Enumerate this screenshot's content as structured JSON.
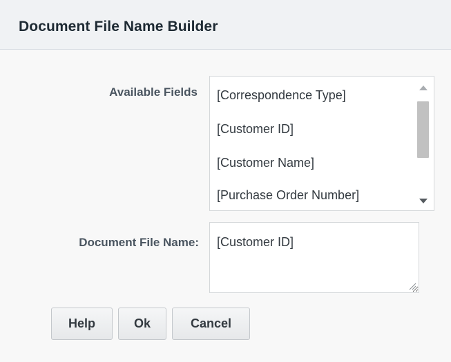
{
  "dialog": {
    "title": "Document File Name Builder"
  },
  "available_fields": {
    "label": "Available Fields",
    "items": [
      "[Correspondence Type]",
      "[Customer ID]",
      "[Customer Name]",
      "[Purchase Order Number]"
    ]
  },
  "file_name": {
    "label": "Document File Name:",
    "value": "[Customer ID]"
  },
  "buttons": {
    "help": "Help",
    "ok": "Ok",
    "cancel": "Cancel"
  }
}
